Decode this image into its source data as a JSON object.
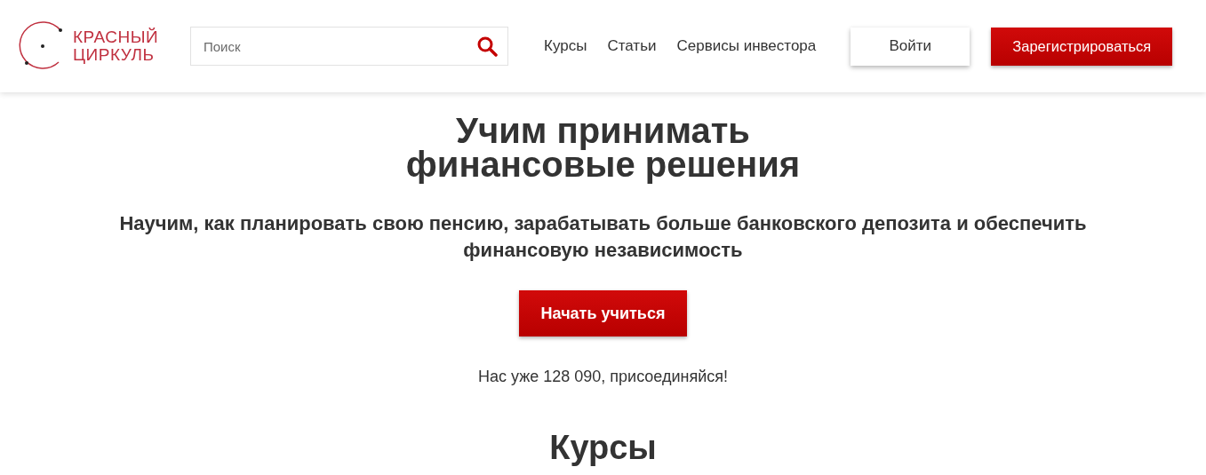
{
  "header": {
    "logo": {
      "line1": "КРАСНЫЙ",
      "line2": "ЦИРКУЛЬ"
    },
    "search": {
      "placeholder": "Поиск"
    },
    "nav": [
      "Курсы",
      "Статьи",
      "Сервисы инвестора"
    ],
    "login": "Войти",
    "register": "Зарегистрироваться"
  },
  "hero": {
    "title_lines": [
      "Учим принимать",
      "финансовые решения"
    ],
    "subtitle": "Научим, как планировать свою пенсию, зарабатывать больше банковского депозита и обеспечить финансовую независимость",
    "cta": "Начать учиться",
    "members": "Нас уже 128 090, присоединяйся!"
  },
  "courses": {
    "title": "Курсы"
  }
}
